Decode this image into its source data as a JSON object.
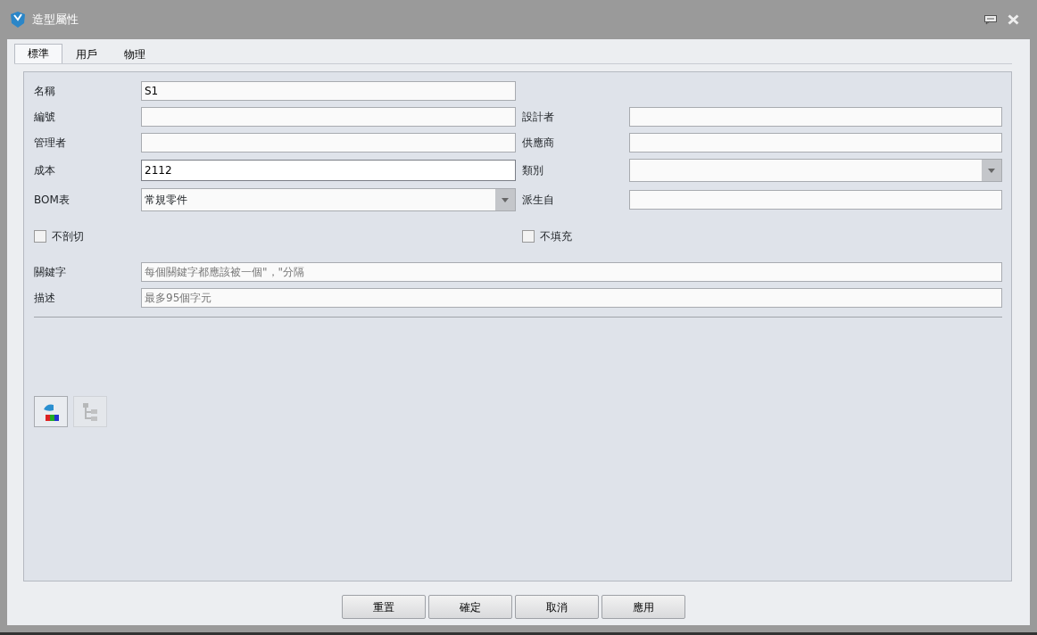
{
  "window": {
    "title": "造型屬性"
  },
  "tabs": [
    {
      "label": "標準",
      "selected": true
    },
    {
      "label": "用戶",
      "selected": false
    },
    {
      "label": "物理",
      "selected": false
    }
  ],
  "rows": [
    {
      "cells": [
        {
          "label": "名稱",
          "kind": "text",
          "value": "S1"
        }
      ]
    },
    {
      "cells": [
        {
          "label": "編號",
          "kind": "text"
        },
        {
          "label": "設計者",
          "kind": "text"
        }
      ]
    },
    {
      "cells": [
        {
          "label": "管理者",
          "kind": "text"
        },
        {
          "label": "供應商",
          "kind": "text"
        }
      ]
    },
    {
      "cells": [
        {
          "label": "成本",
          "kind": "text",
          "value": "2112",
          "focused": true
        },
        {
          "label": "類別",
          "kind": "combo"
        }
      ]
    },
    {
      "cells": [
        {
          "label": "BOM表",
          "kind": "combo",
          "value": "常規零件"
        },
        {
          "label": "派生自",
          "kind": "text"
        }
      ]
    }
  ],
  "checkboxes": [
    {
      "label": "不剖切",
      "checked": false
    },
    {
      "label": "不填充",
      "checked": false
    }
  ],
  "wide_fields": [
    {
      "label": "關鍵字",
      "placeholder": "每個關鍵字都應該被一個\"，\"分隔"
    },
    {
      "label": "描述",
      "placeholder": "最多95個字元"
    }
  ],
  "tool_buttons": [
    {
      "kind": "appearance",
      "disabled": false
    },
    {
      "kind": "tree",
      "disabled": true
    }
  ],
  "buttons": [
    "重置",
    "確定",
    "取消",
    "應用"
  ]
}
